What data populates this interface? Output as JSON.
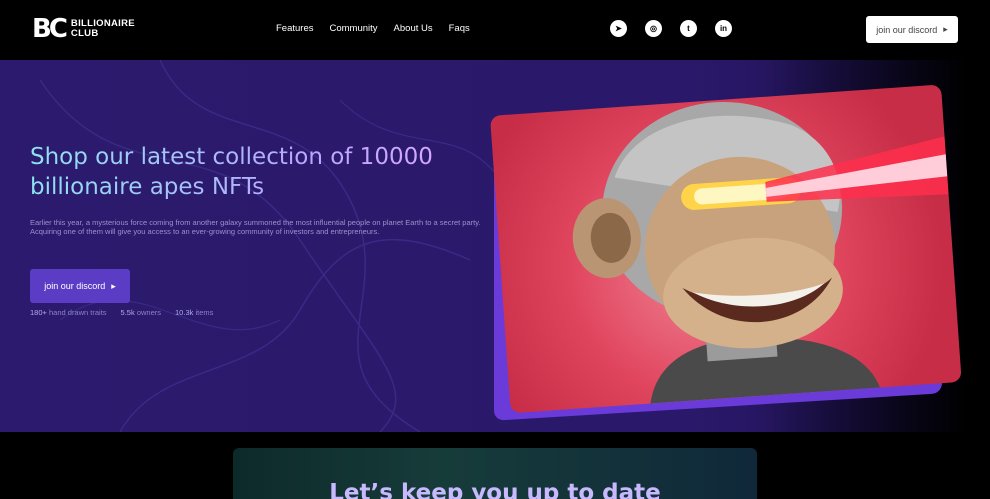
{
  "brand": {
    "mark": "BC",
    "name_line1": "BILLIONAIRE",
    "name_line2": "CLUB"
  },
  "nav": {
    "links": [
      "Features",
      "Community",
      "About Us",
      "Faqs"
    ]
  },
  "socials": [
    {
      "icon": "telegram-icon",
      "glyph": "➤"
    },
    {
      "icon": "instagram-icon",
      "glyph": "◎"
    },
    {
      "icon": "twitter-icon",
      "glyph": "t"
    },
    {
      "icon": "linkedin-icon",
      "glyph": "in"
    }
  ],
  "header_button": {
    "label": "join our discord",
    "icon": "caret-right-icon"
  },
  "hero": {
    "headline": "Shop our latest collection of 10000 billionaire apes NFTs",
    "description": "Earlier this year, a mysterious force coming from another galaxy summoned the most influential people on planet Earth to a secret party. Acquiring one of them will give you access to an ever-growing community of investors and entrepreneurs.",
    "cta_label": "join our discord",
    "stats": [
      {
        "value": "180+",
        "label": "hand drawn traits"
      },
      {
        "value": "5.5k",
        "label": "owners"
      },
      {
        "value": "10.3k",
        "label": "items"
      }
    ]
  },
  "lower": {
    "title": "Let’s keep you up to date"
  },
  "colors": {
    "hero_bg": "#2c1a6e",
    "cta": "#5b3cc4",
    "card_red": "#e0455e",
    "card_purple": "#6a3bd8"
  }
}
